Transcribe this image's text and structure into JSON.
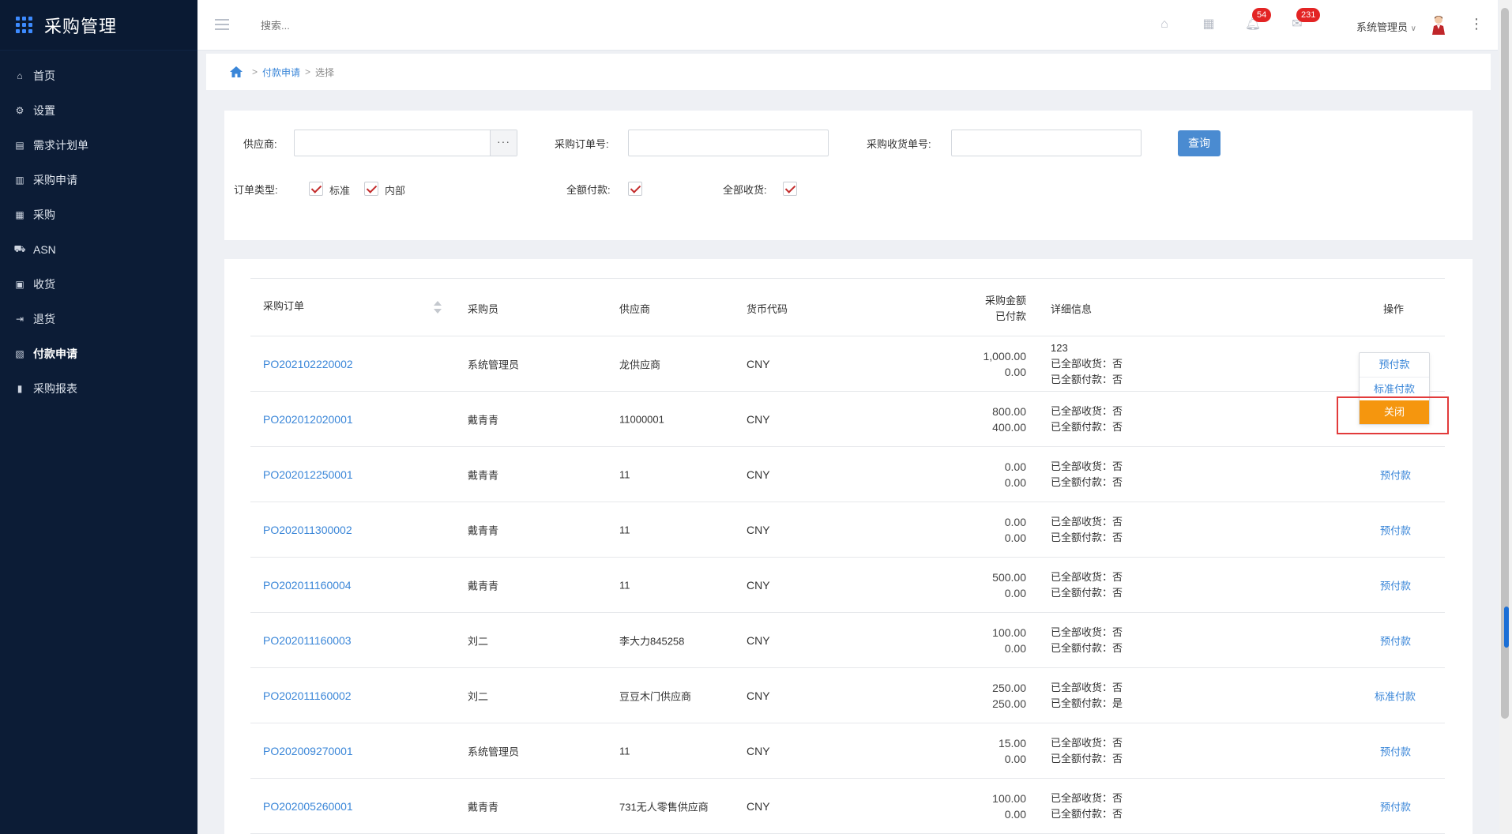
{
  "app": {
    "title": "采购管理"
  },
  "sidebar": {
    "items": [
      {
        "label": "首页",
        "icon": "home-icon"
      },
      {
        "label": "设置",
        "icon": "gear-icon"
      },
      {
        "label": "需求计划单",
        "icon": "document-icon"
      },
      {
        "label": "采购申请",
        "icon": "form-icon"
      },
      {
        "label": "采购",
        "icon": "receipt-icon"
      },
      {
        "label": "ASN",
        "icon": "truck-icon"
      },
      {
        "label": "收货",
        "icon": "inbox-icon"
      },
      {
        "label": "退货",
        "icon": "return-icon"
      },
      {
        "label": "付款申请",
        "icon": "payment-icon",
        "active": true
      },
      {
        "label": "采购报表",
        "icon": "bar-chart-icon"
      }
    ]
  },
  "header": {
    "search_placeholder": "搜索...",
    "notifications_count": "54",
    "messages_count": "231",
    "user_name": "系统管理员"
  },
  "breadcrumb": {
    "items": [
      "付款申请",
      "选择"
    ]
  },
  "filters": {
    "supplier_label": "供应商:",
    "supplier_value": "",
    "po_number_label": "采购订单号:",
    "po_number_value": "",
    "receipt_number_label": "采购收货单号:",
    "receipt_number_value": "",
    "query_button": "查询",
    "order_type_label": "订单类型:",
    "order_type_options": [
      {
        "label": "标准",
        "checked": true
      },
      {
        "label": "内部",
        "checked": true
      }
    ],
    "full_payment_label": "全额付款:",
    "full_payment_checked": true,
    "full_receipt_label": "全部收货:",
    "full_receipt_checked": true
  },
  "table": {
    "headers": {
      "po": "采购订单",
      "buyer": "采购员",
      "vendor": "供应商",
      "currency": "货币代码",
      "amount_line1": "采购金额",
      "amount_line2": "已付款",
      "details": "详细信息",
      "actions": "操作"
    },
    "rows": [
      {
        "po": "PO202102220002",
        "buyer": "系统管理员",
        "vendor": "龙供应商",
        "currency": "CNY",
        "amount": "1,000.00",
        "paid": "0.00",
        "detail_extra": "123",
        "received": "已全部收货：否",
        "fully_paid": "已全额付款：否",
        "action": ""
      },
      {
        "po": "PO202012020001",
        "buyer": "戴青青",
        "vendor": "11000001",
        "currency": "CNY",
        "amount": "800.00",
        "paid": "400.00",
        "detail_extra": "",
        "received": "已全部收货：否",
        "fully_paid": "已全额付款：否",
        "action": ""
      },
      {
        "po": "PO202012250001",
        "buyer": "戴青青",
        "vendor": "11",
        "currency": "CNY",
        "amount": "0.00",
        "paid": "0.00",
        "detail_extra": "",
        "received": "已全部收货：否",
        "fully_paid": "已全额付款：否",
        "action": "预付款"
      },
      {
        "po": "PO202011300002",
        "buyer": "戴青青",
        "vendor": "11",
        "currency": "CNY",
        "amount": "0.00",
        "paid": "0.00",
        "detail_extra": "",
        "received": "已全部收货：否",
        "fully_paid": "已全额付款：否",
        "action": "预付款"
      },
      {
        "po": "PO202011160004",
        "buyer": "戴青青",
        "vendor": "11",
        "currency": "CNY",
        "amount": "500.00",
        "paid": "0.00",
        "detail_extra": "",
        "received": "已全部收货：否",
        "fully_paid": "已全额付款：否",
        "action": "预付款"
      },
      {
        "po": "PO202011160003",
        "buyer": "刘二",
        "vendor": "李大力845258",
        "currency": "CNY",
        "amount": "100.00",
        "paid": "0.00",
        "detail_extra": "",
        "received": "已全部收货：否",
        "fully_paid": "已全额付款：否",
        "action": "预付款"
      },
      {
        "po": "PO202011160002",
        "buyer": "刘二",
        "vendor": "豆豆木门供应商",
        "currency": "CNY",
        "amount": "250.00",
        "paid": "250.00",
        "detail_extra": "",
        "received": "已全部收货：否",
        "fully_paid": "已全额付款：是",
        "action": "标准付款"
      },
      {
        "po": "PO202009270001",
        "buyer": "系统管理员",
        "vendor": "11",
        "currency": "CNY",
        "amount": "15.00",
        "paid": "0.00",
        "detail_extra": "",
        "received": "已全部收货：否",
        "fully_paid": "已全额付款：否",
        "action": "预付款"
      },
      {
        "po": "PO202005260001",
        "buyer": "戴青青",
        "vendor": "731无人零售供应商",
        "currency": "CNY",
        "amount": "100.00",
        "paid": "0.00",
        "detail_extra": "",
        "received": "已全部收货：否",
        "fully_paid": "已全额付款：否",
        "action": "预付款"
      }
    ]
  },
  "dropdown": {
    "items": [
      "预付款",
      "标准付款",
      "关闭"
    ]
  },
  "colors": {
    "sidebar_bg": "#0c1c36",
    "link": "#3a86d8",
    "primary_button": "#4a8bd1",
    "close_button": "#f5960e",
    "highlight": "#e23b3b",
    "badge": "#e32424"
  }
}
